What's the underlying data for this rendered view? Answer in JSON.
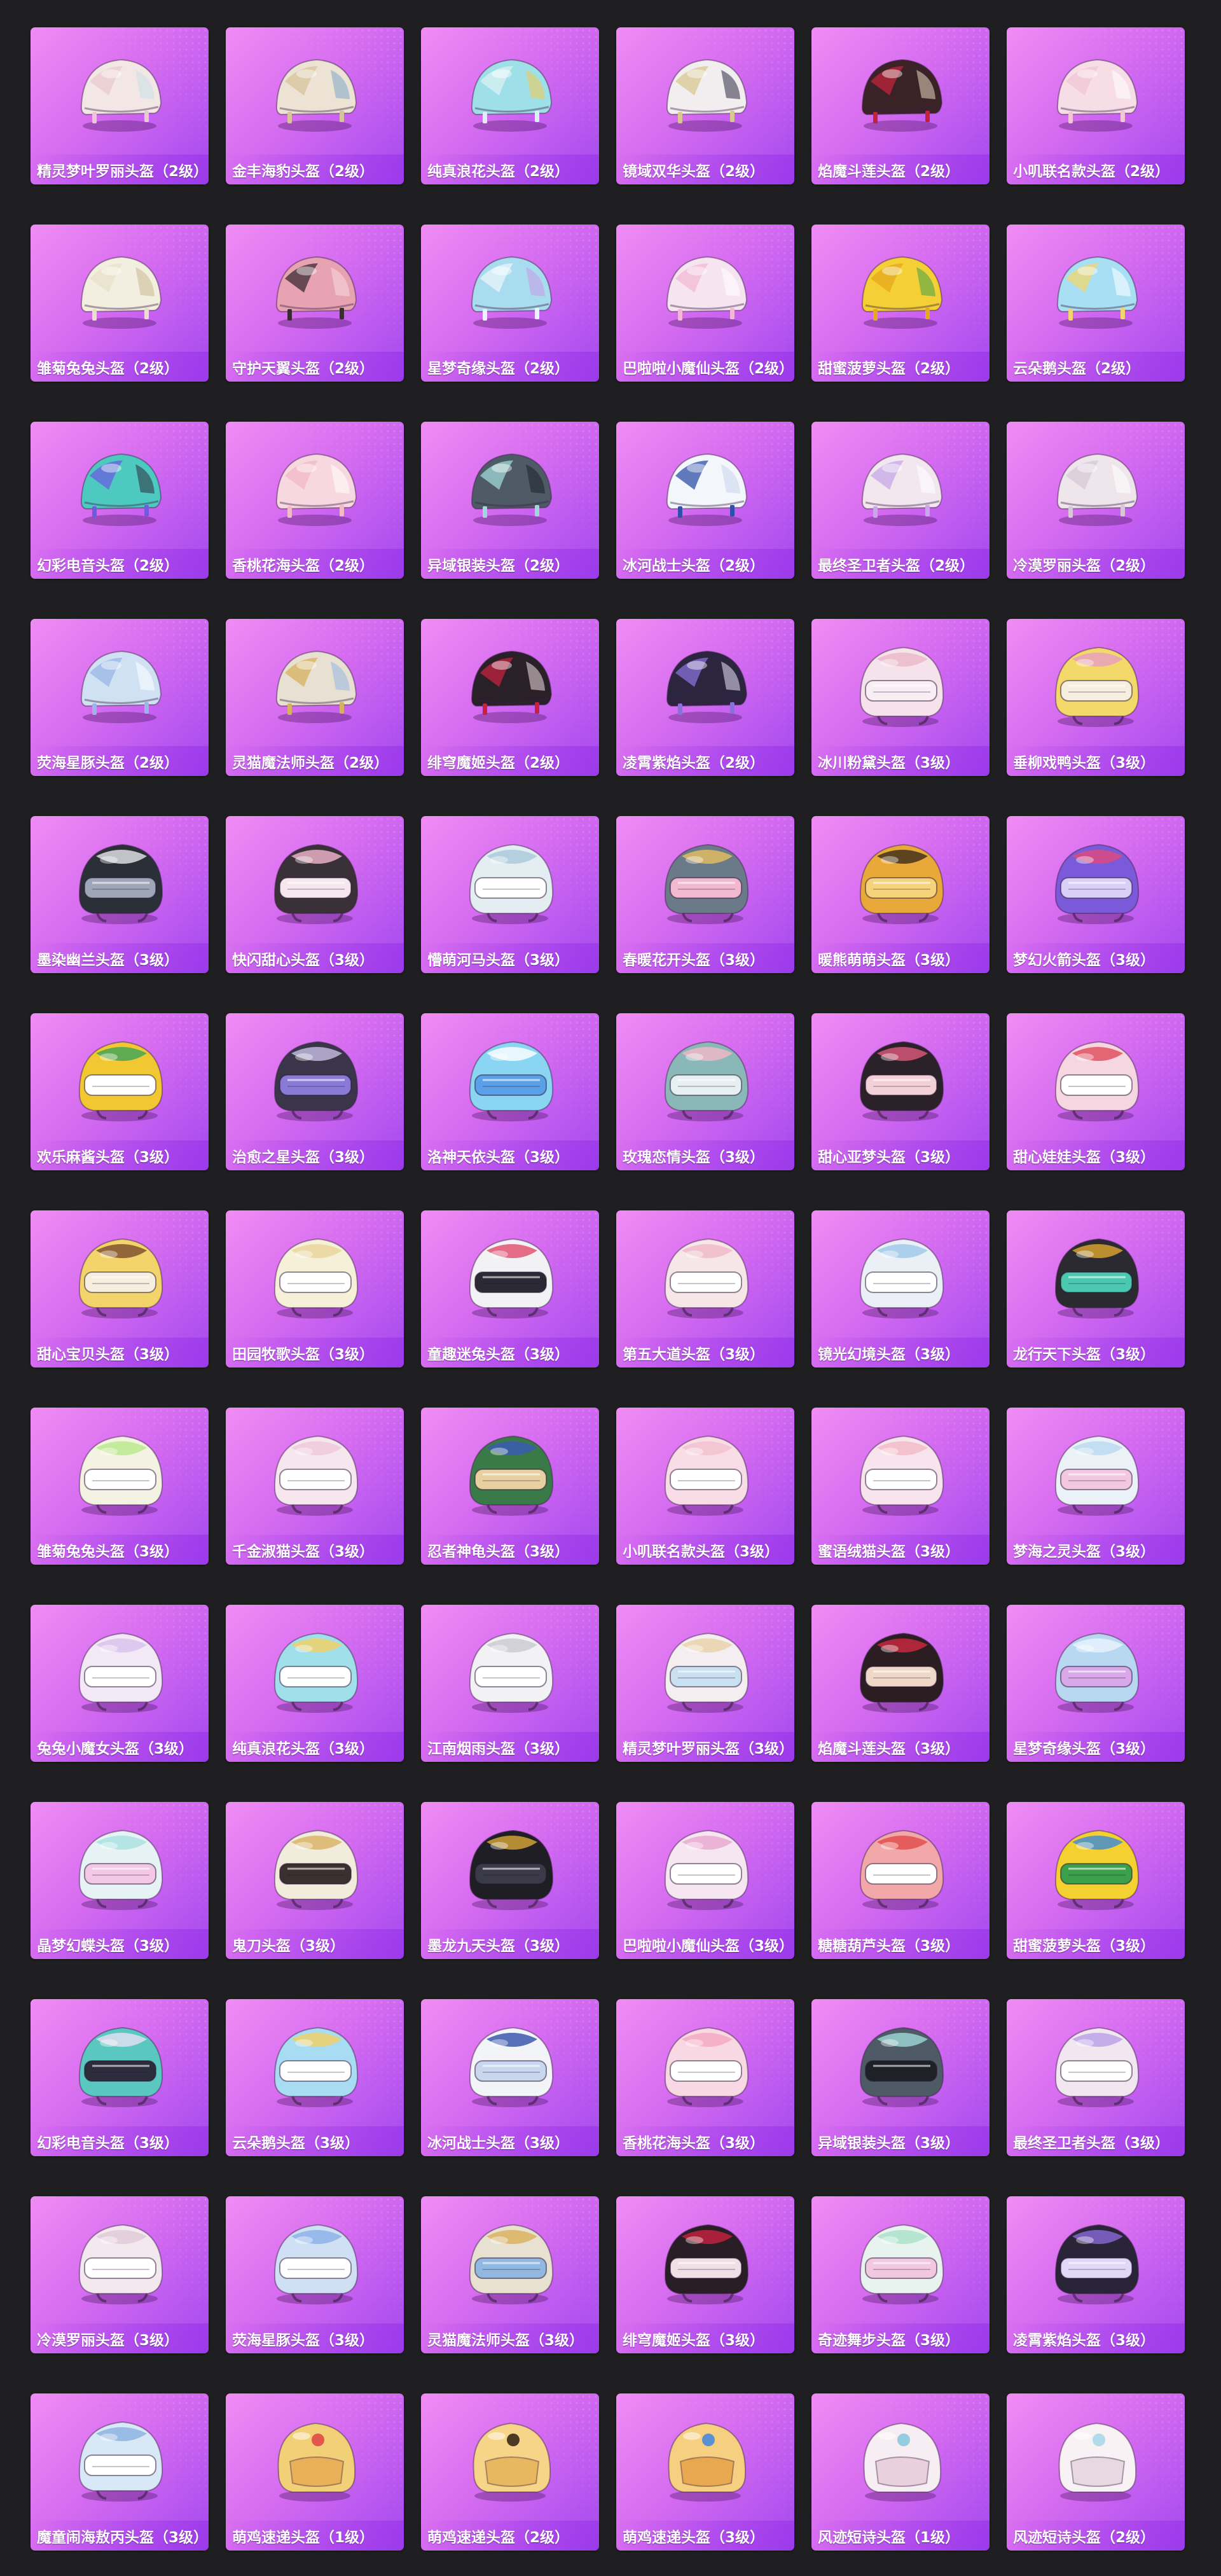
{
  "items": [
    {
      "name": "精灵梦叶罗丽头盔（2级）",
      "style": "cap",
      "c1": "#f3e7e5",
      "c2": "#e9c9cf",
      "c3": "#c9e0e8"
    },
    {
      "name": "金丰海豹头盔（2级）",
      "style": "cap",
      "c1": "#ece3d4",
      "c2": "#d8c39c",
      "c3": "#7ea8c8"
    },
    {
      "name": "纯真浪花头盔（2级）",
      "style": "cap",
      "c1": "#9fe0e8",
      "c2": "#d9f1f3",
      "c3": "#f2c94c"
    },
    {
      "name": "镜域双华头盔（2级）",
      "style": "cap",
      "c1": "#f2eef0",
      "c2": "#d8c790",
      "c3": "#2b2c46"
    },
    {
      "name": "焰魔斗莲头盔（2级）",
      "style": "cap",
      "c1": "#3a2226",
      "c2": "#c0243c",
      "c3": "#e8d8c0"
    },
    {
      "name": "小叽联名款头盔（2级）",
      "style": "cap",
      "c1": "#f7dde6",
      "c2": "#f1c6d5",
      "c3": "#ffffff"
    },
    {
      "name": "雏菊兔兔头盔（2级）",
      "style": "cap",
      "c1": "#f3efe0",
      "c2": "#e8e0c8",
      "c3": "#c8b890"
    },
    {
      "name": "守护天翼头盔（2级）",
      "style": "cap",
      "c1": "#e8a3b3",
      "c2": "#3b2b33",
      "c3": "#f6d8df"
    },
    {
      "name": "星梦奇缘头盔（2级）",
      "style": "cap",
      "c1": "#a9dcef",
      "c2": "#e8f6fb",
      "c3": "#c89be8"
    },
    {
      "name": "巴啦啦小魔仙头盔（2级）",
      "style": "cap",
      "c1": "#f6e5f0",
      "c2": "#f2b8d6",
      "c3": "#ffffff"
    },
    {
      "name": "甜蜜菠萝头盔（2级）",
      "style": "cap",
      "c1": "#f4cf36",
      "c2": "#e6a81e",
      "c3": "#3fa44a"
    },
    {
      "name": "云朵鹅头盔（2级）",
      "style": "cap",
      "c1": "#a8dff3",
      "c2": "#f2d56e",
      "c3": "#ffffff"
    },
    {
      "name": "幻彩电音头盔（2级）",
      "style": "cap",
      "c1": "#4ec9c0",
      "c2": "#6a5de0",
      "c3": "#2c2c3c"
    },
    {
      "name": "香桃花海头盔（2级）",
      "style": "cap",
      "c1": "#f8d8e0",
      "c2": "#f2b9c8",
      "c3": "#ffffff"
    },
    {
      "name": "异域银装头盔（2级）",
      "style": "cap",
      "c1": "#4e5a66",
      "c2": "#9fd8d8",
      "c3": "#1e2228"
    },
    {
      "name": "冰河战士头盔（2级）",
      "style": "cap",
      "c1": "#f3f6fa",
      "c2": "#2f4fa8",
      "c3": "#c8d6ee"
    },
    {
      "name": "最终圣卫者头盔（2级）",
      "style": "cap",
      "c1": "#f2e6ef",
      "c2": "#c7a8e8",
      "c3": "#ffffff"
    },
    {
      "name": "冷漠罗丽头盔（2级）",
      "style": "cap",
      "c1": "#efe6ec",
      "c2": "#d7c8d8",
      "c3": "#ffffff"
    },
    {
      "name": "荧海星豚头盔（2级）",
      "style": "cap",
      "c1": "#cfe1f3",
      "c2": "#9bb5e6",
      "c3": "#ffffff"
    },
    {
      "name": "灵猫魔法师头盔（2级）",
      "style": "cap",
      "c1": "#e8e0d2",
      "c2": "#d6b25e",
      "c3": "#93b8e0"
    },
    {
      "name": "绯穹魔姬头盔（2级）",
      "style": "cap",
      "c1": "#2a2028",
      "c2": "#c4223e",
      "c3": "#f0e0e0"
    },
    {
      "name": "凌霄紫焰头盔（2级）",
      "style": "cap",
      "c1": "#2b2540",
      "c2": "#8a70d8",
      "c3": "#eae4f8"
    },
    {
      "name": "冰川粉黛头盔（3级）",
      "style": "visor",
      "c1": "#f6e2ea",
      "c2": "#eab8c8",
      "c3": "#f8eef4"
    },
    {
      "name": "垂柳戏鸭头盔（3级）",
      "style": "visor",
      "c1": "#f3d86a",
      "c2": "#e59fc0",
      "c3": "#f6efe0"
    },
    {
      "name": "墨染幽兰头盔（3级）",
      "style": "visor",
      "c1": "#2b3038",
      "c2": "#e8e8ee",
      "c3": "#9ea6b8"
    },
    {
      "name": "快闪甜心头盔（3级）",
      "style": "visor",
      "c1": "#3a3038",
      "c2": "#f2b8cc",
      "c3": "#f6e6ee"
    },
    {
      "name": "懵萌河马头盔（3级）",
      "style": "visor",
      "c1": "#e4eef2",
      "c2": "#a8c8d8",
      "c3": "#ffffff"
    },
    {
      "name": "春暖花开头盔（3级）",
      "style": "visor",
      "c1": "#6a7a88",
      "c2": "#e8c060",
      "c3": "#f2b8d0"
    },
    {
      "name": "暖熊萌萌头盔（3级）",
      "style": "visor",
      "c1": "#e8a83a",
      "c2": "#3a2a1a",
      "c3": "#f6d27a"
    },
    {
      "name": "梦幻火箭头盔（3级）",
      "style": "visor",
      "c1": "#7a5ad8",
      "c2": "#e2487a",
      "c3": "#d8d0f6"
    },
    {
      "name": "欢乐麻酱头盔（3级）",
      "style": "visor",
      "c1": "#f2c832",
      "c2": "#3aa45a",
      "c3": "#ffffff"
    },
    {
      "name": "治愈之星头盔（3级）",
      "style": "visor",
      "c1": "#3a3548",
      "c2": "#c8c0e6",
      "c3": "#8a7ad8"
    },
    {
      "name": "洛神天依头盔（3级）",
      "style": "visor",
      "c1": "#8ad6f2",
      "c2": "#ffffff",
      "c3": "#5aa0e8"
    },
    {
      "name": "玫瑰恋情头盔（3级）",
      "style": "visor",
      "c1": "#8ab8b8",
      "c2": "#f2b8c8",
      "c3": "#e6f0f2"
    },
    {
      "name": "甜心亚梦头盔（3级）",
      "style": "visor",
      "c1": "#2a2228",
      "c2": "#e05a7a",
      "c3": "#f2d0d8"
    },
    {
      "name": "甜心娃娃头盔（3级）",
      "style": "visor",
      "c1": "#f6d6e0",
      "c2": "#e04a5a",
      "c3": "#ffffff"
    },
    {
      "name": "甜心宝贝头盔（3级）",
      "style": "visor",
      "c1": "#f2d46a",
      "c2": "#7a4a2a",
      "c3": "#f6efe0"
    },
    {
      "name": "田园牧歌头盔（3级）",
      "style": "visor",
      "c1": "#f6f0d8",
      "c2": "#e8d49a",
      "c3": "#ffffff"
    },
    {
      "name": "童趣迷兔头盔（3级）",
      "style": "visor",
      "c1": "#f2f2f4",
      "c2": "#e04a6a",
      "c3": "#2a2a34"
    },
    {
      "name": "第五大道头盔（3级）",
      "style": "visor",
      "c1": "#f6e6e8",
      "c2": "#f0b8c8",
      "c3": "#ffffff"
    },
    {
      "name": "镜光幻境头盔（3级）",
      "style": "visor",
      "c1": "#eaf0f6",
      "c2": "#9cc8e8",
      "c3": "#ffffff"
    },
    {
      "name": "龙行天下头盔（3级）",
      "style": "visor",
      "c1": "#2a2a30",
      "c2": "#e0a830",
      "c3": "#4ac8b0"
    },
    {
      "name": "雏菊兔兔头盔（3级）",
      "style": "visor",
      "c1": "#f4f2e2",
      "c2": "#b8e88a",
      "c3": "#ffffff"
    },
    {
      "name": "千金淑猫头盔（3级）",
      "style": "visor",
      "c1": "#f6e6ee",
      "c2": "#f0c8d8",
      "c3": "#ffffff"
    },
    {
      "name": "忍者神龟头盔（3级）",
      "style": "visor",
      "c1": "#3a7a48",
      "c2": "#3a5ab8",
      "c3": "#e8d0a0"
    },
    {
      "name": "小叽联名款头盔（3级）",
      "style": "visor",
      "c1": "#f8dde6",
      "c2": "#f2c0d0",
      "c3": "#ffffff"
    },
    {
      "name": "蜜语绒猫头盔（3级）",
      "style": "visor",
      "c1": "#f8e4ec",
      "c2": "#f2b8c8",
      "c3": "#ffffff"
    },
    {
      "name": "梦海之灵头盔（3级）",
      "style": "visor",
      "c1": "#eaf2f8",
      "c2": "#b8d8ee",
      "c3": "#f2c8e0"
    },
    {
      "name": "兔兔小魔女头盔（3级）",
      "style": "visor",
      "c1": "#f2e8f6",
      "c2": "#d8c0ec",
      "c3": "#ffffff"
    },
    {
      "name": "纯真浪花头盔（3级）",
      "style": "visor",
      "c1": "#9fe0ea",
      "c2": "#f2d060",
      "c3": "#ffffff"
    },
    {
      "name": "江南烟雨头盔（3级）",
      "style": "visor",
      "c1": "#f2f2f4",
      "c2": "#c8c8d0",
      "c3": "#ffffff"
    },
    {
      "name": "精灵梦叶罗丽头盔（3级）",
      "style": "visor",
      "c1": "#f4eef0",
      "c2": "#e8d0a8",
      "c3": "#c8e0f0"
    },
    {
      "name": "焰魔斗莲头盔（3级）",
      "style": "visor",
      "c1": "#2a1e22",
      "c2": "#d02840",
      "c3": "#f0d8c8"
    },
    {
      "name": "星梦奇缘头盔（3级）",
      "style": "visor",
      "c1": "#b8d8f2",
      "c2": "#e8f4fb",
      "c3": "#d8a8e8"
    },
    {
      "name": "晶梦幻蝶头盔（3级）",
      "style": "visor",
      "c1": "#e6f2f4",
      "c2": "#a8e0e0",
      "c3": "#f2c8e6"
    },
    {
      "name": "鬼刀头盔（3级）",
      "style": "visor",
      "c1": "#f2ecdc",
      "c2": "#d8b060",
      "c3": "#3a3030"
    },
    {
      "name": "墨龙九天头盔（3级）",
      "style": "visor",
      "c1": "#1e1e24",
      "c2": "#d8a838",
      "c3": "#3a3a48"
    },
    {
      "name": "巴啦啦小魔仙头盔（3级）",
      "style": "visor",
      "c1": "#f6e6f2",
      "c2": "#e8a8d0",
      "c3": "#ffffff"
    },
    {
      "name": "糖糖葫芦头盔（3级）",
      "style": "visor",
      "c1": "#f2a8a8",
      "c2": "#e04848",
      "c3": "#ffffff"
    },
    {
      "name": "甜蜜菠萝头盔（3级）",
      "style": "visor",
      "c1": "#f4d030",
      "c2": "#3a8ad8",
      "c3": "#3aa04a"
    },
    {
      "name": "幻彩电音头盔（3级）",
      "style": "visor",
      "c1": "#5ac8c0",
      "c2": "#e8e0f2",
      "c3": "#2c2c3c"
    },
    {
      "name": "云朵鹅头盔（3级）",
      "style": "visor",
      "c1": "#a8dcf2",
      "c2": "#f2d060",
      "c3": "#ffffff"
    },
    {
      "name": "冰河战士头盔（3级）",
      "style": "visor",
      "c1": "#f2f4f8",
      "c2": "#2f4fa8",
      "c3": "#c8d6ee"
    },
    {
      "name": "香桃花海头盔（3级）",
      "style": "visor",
      "c1": "#f8d8e2",
      "c2": "#f2a8c0",
      "c3": "#ffffff"
    },
    {
      "name": "异域银装头盔（3级）",
      "style": "visor",
      "c1": "#4e5a66",
      "c2": "#9fd8d8",
      "c3": "#1e2228"
    },
    {
      "name": "最终圣卫者头盔（3级）",
      "style": "visor",
      "c1": "#f2e6f0",
      "c2": "#b8a0e8",
      "c3": "#ffffff"
    },
    {
      "name": "冷漠罗丽头盔（3级）",
      "style": "visor",
      "c1": "#f2e8ee",
      "c2": "#e0c8d8",
      "c3": "#ffffff"
    },
    {
      "name": "荧海星豚头盔（3级）",
      "style": "visor",
      "c1": "#cfe0f4",
      "c2": "#8ab0e8",
      "c3": "#ffffff"
    },
    {
      "name": "灵猫魔法师头盔（3级）",
      "style": "visor",
      "c1": "#e8e0d0",
      "c2": "#d8b05a",
      "c3": "#90b8e0"
    },
    {
      "name": "绯穹魔姬头盔（3级）",
      "style": "visor",
      "c1": "#2a1e26",
      "c2": "#c82040",
      "c3": "#f0e0e6"
    },
    {
      "name": "奇迹舞步头盔（3级）",
      "style": "visor",
      "c1": "#e8f2ee",
      "c2": "#a8e0c8",
      "c3": "#f2c8e0"
    },
    {
      "name": "凌霄紫焰头盔（3级）",
      "style": "visor",
      "c1": "#2a2438",
      "c2": "#8a6ad8",
      "c3": "#e0d8f6"
    },
    {
      "name": "魔童闹海敖丙头盔（3级）",
      "style": "visor",
      "c1": "#d8e8f6",
      "c2": "#8ab0e0",
      "c3": "#ffffff"
    },
    {
      "name": "萌鸡速递头盔（1级）",
      "style": "moto",
      "c1": "#f2d078",
      "c2": "#e8b058",
      "c3": "#e04848"
    },
    {
      "name": "萌鸡速递头盔（2级）",
      "style": "moto",
      "c1": "#f6d488",
      "c2": "#e8b860",
      "c3": "#3a2a1a"
    },
    {
      "name": "萌鸡速递头盔（3级）",
      "style": "moto",
      "c1": "#f6d080",
      "c2": "#e8a850",
      "c3": "#4a8ad8"
    },
    {
      "name": "风迹短诗头盔（1级）",
      "style": "moto",
      "c1": "#f6eef2",
      "c2": "#e8d0dc",
      "c3": "#8ac8e0"
    },
    {
      "name": "风迹短诗头盔（2级）",
      "style": "moto",
      "c1": "#f8f2f4",
      "c2": "#e8d8e0",
      "c3": "#a8d8e8"
    }
  ]
}
